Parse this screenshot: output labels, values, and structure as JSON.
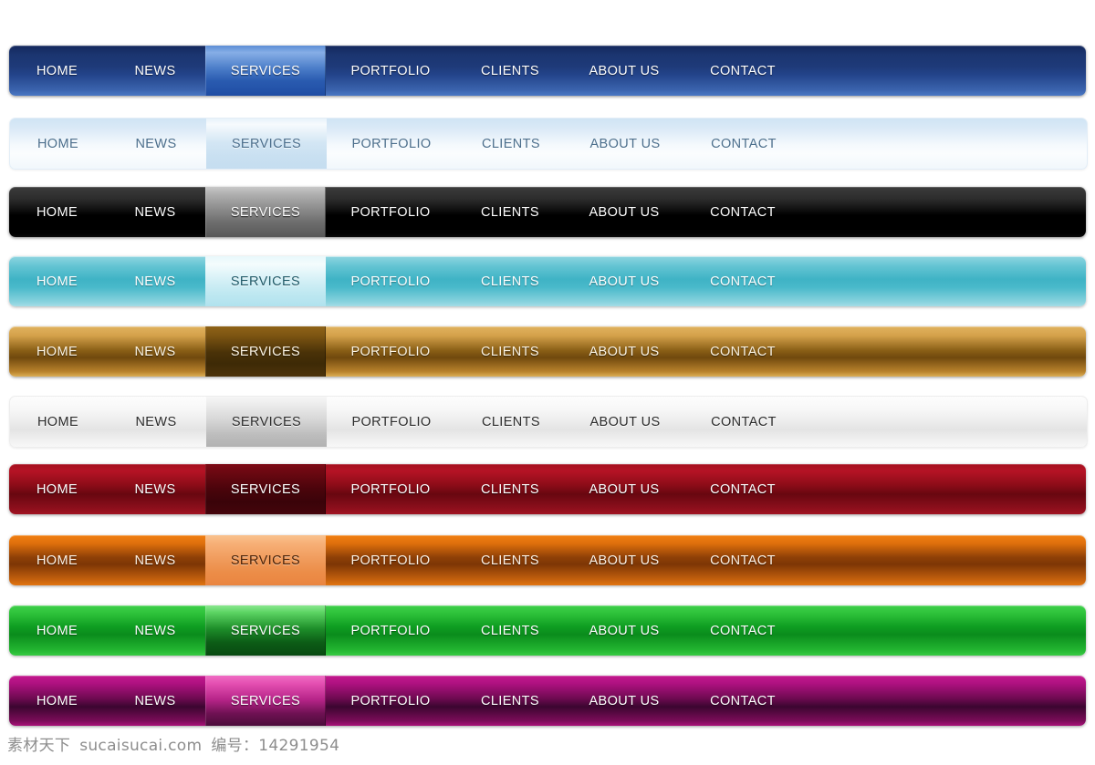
{
  "menu_items": [
    "HOME",
    "NEWS",
    "SERVICES",
    "PORTFOLIO",
    "CLIENTS",
    "ABOUT US",
    "CONTACT"
  ],
  "active_item": "SERVICES",
  "navbars": [
    {
      "name": "dark-blue",
      "style_key": "r-blue",
      "description": "Dark blue glossy navigation bar",
      "base_color": "#1e3a79",
      "active_color": "#4a7cc8",
      "text_color": "#ffffff",
      "items": [
        "HOME",
        "NEWS",
        "SERVICES",
        "PORTFOLIO",
        "CLIENTS",
        "ABOUT US",
        "CONTACT"
      ]
    },
    {
      "name": "pale-blue",
      "style_key": "r-paleblue",
      "description": "Pale blue light navigation bar",
      "base_color": "#dceaf7",
      "active_color": "#c9e0f1",
      "text_color": "#4b6e8c",
      "items": [
        "HOME",
        "NEWS",
        "SERVICES",
        "PORTFOLIO",
        "CLIENTS",
        "ABOUT US",
        "CONTACT"
      ]
    },
    {
      "name": "black",
      "style_key": "r-black",
      "description": "Black glossy navigation bar",
      "base_color": "#000000",
      "active_color": "#8c8c8c",
      "text_color": "#ffffff",
      "items": [
        "HOME",
        "NEWS",
        "SERVICES",
        "PORTFOLIO",
        "CLIENTS",
        "ABOUT US",
        "CONTACT"
      ]
    },
    {
      "name": "cyan",
      "style_key": "r-cyan",
      "description": "Cyan turquoise navigation bar",
      "base_color": "#3fb3c5",
      "active_color": "#d4f0f6",
      "text_color": "#ffffff",
      "items": [
        "HOME",
        "NEWS",
        "SERVICES",
        "PORTFOLIO",
        "CLIENTS",
        "ABOUT US",
        "CONTACT"
      ]
    },
    {
      "name": "gold",
      "style_key": "r-gold",
      "description": "Gold brown navigation bar",
      "base_color": "#8a5f16",
      "active_color": "#4a3208",
      "text_color": "#fdf5e4",
      "items": [
        "HOME",
        "NEWS",
        "SERVICES",
        "PORTFOLIO",
        "CLIENTS",
        "ABOUT US",
        "CONTACT"
      ]
    },
    {
      "name": "white-silver",
      "style_key": "r-white",
      "description": "White silver navigation bar",
      "base_color": "#ececec",
      "active_color": "#d5d5d5",
      "text_color": "#2b2b2b",
      "items": [
        "HOME",
        "NEWS",
        "SERVICES",
        "PORTFOLIO",
        "CLIENTS",
        "ABOUT US",
        "CONTACT"
      ]
    },
    {
      "name": "dark-red",
      "style_key": "r-red",
      "description": "Dark red crimson navigation bar",
      "base_color": "#8c0c18",
      "active_color": "#4a040b",
      "text_color": "#ffffff",
      "items": [
        "HOME",
        "NEWS",
        "SERVICES",
        "PORTFOLIO",
        "CLIENTS",
        "ABOUT US",
        "CONTACT"
      ]
    },
    {
      "name": "orange",
      "style_key": "r-orange",
      "description": "Orange navigation bar",
      "base_color": "#e0700c",
      "active_color": "#f09b5c",
      "text_color": "#fff3e6",
      "items": [
        "HOME",
        "NEWS",
        "SERVICES",
        "PORTFOLIO",
        "CLIENTS",
        "ABOUT US",
        "CONTACT"
      ]
    },
    {
      "name": "green",
      "style_key": "r-green",
      "description": "Green navigation bar",
      "base_color": "#0f9e22",
      "active_color": "#1e8f2a",
      "text_color": "#ffffff",
      "items": [
        "HOME",
        "NEWS",
        "SERVICES",
        "PORTFOLIO",
        "CLIENTS",
        "ABOUT US",
        "CONTACT"
      ]
    },
    {
      "name": "magenta",
      "style_key": "r-magenta",
      "description": "Magenta pink navigation bar",
      "base_color": "#ae1180",
      "active_color": "#b62488",
      "text_color": "#ffffff",
      "items": [
        "HOME",
        "NEWS",
        "SERVICES",
        "PORTFOLIO",
        "CLIENTS",
        "ABOUT US",
        "CONTACT"
      ]
    }
  ],
  "watermark": {
    "site_name": "素材天下",
    "domain": "sucaisucai.com",
    "id_label": "编号：",
    "id_value": "14291954"
  }
}
